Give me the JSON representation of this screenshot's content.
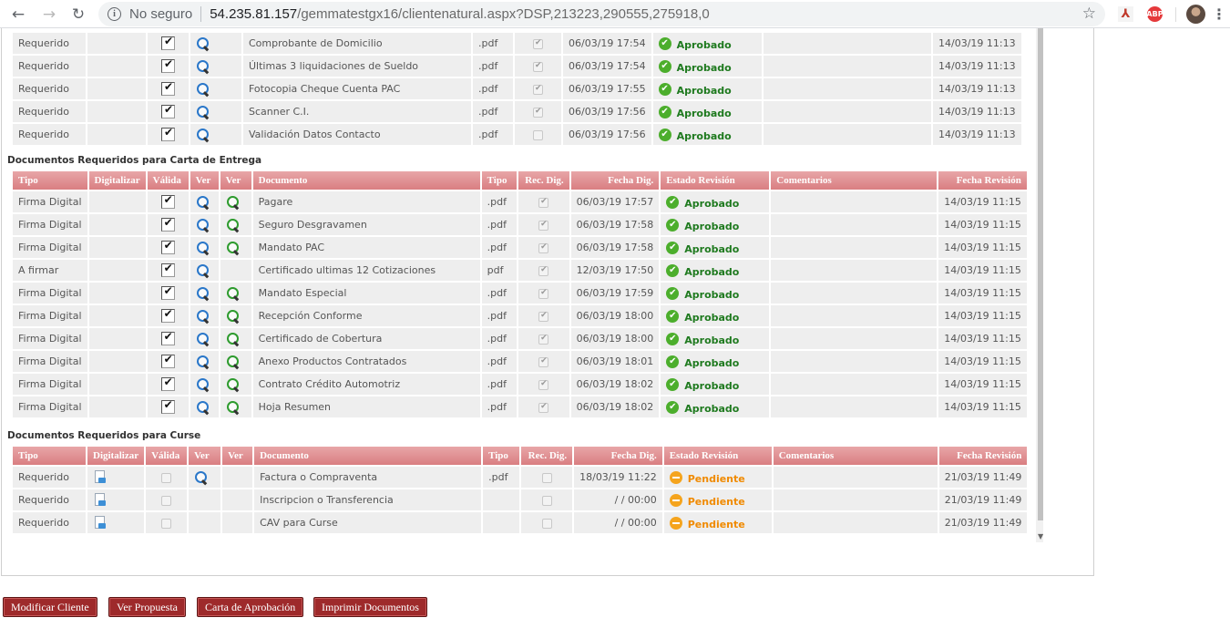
{
  "browser": {
    "security_label": "No seguro",
    "url_host": "54.235.81.157",
    "url_path": "/gemmatestgx16/clientenatural.aspx?DSP,213223,290555,275918,0",
    "pdf_ext_label": "⅄",
    "adblock_ext_label": "ABP"
  },
  "table_top": {
    "rows": [
      {
        "tipo": "Requerido",
        "documento": "Comprobante de Domicilio",
        "ext": ".pdf",
        "fecha_dig": "06/03/19 17:54",
        "estado": "Aprobado",
        "fecha_rev": "14/03/19 11:13"
      },
      {
        "tipo": "Requerido",
        "documento": "Últimas 3 liquidaciones de Sueldo",
        "ext": ".pdf",
        "fecha_dig": "06/03/19 17:54",
        "estado": "Aprobado",
        "fecha_rev": "14/03/19 11:13"
      },
      {
        "tipo": "Requerido",
        "documento": "Fotocopia Cheque Cuenta PAC",
        "ext": ".pdf",
        "fecha_dig": "06/03/19 17:55",
        "estado": "Aprobado",
        "fecha_rev": "14/03/19 11:13"
      },
      {
        "tipo": "Requerido",
        "documento": "Scanner C.I.",
        "ext": ".pdf",
        "fecha_dig": "06/03/19 17:56",
        "estado": "Aprobado",
        "fecha_rev": "14/03/19 11:13"
      },
      {
        "tipo": "Requerido",
        "documento": "Validación Datos Contacto",
        "ext": ".pdf",
        "fecha_dig": "06/03/19 17:56",
        "estado": "Aprobado",
        "fecha_rev": "14/03/19 11:13"
      }
    ]
  },
  "section_carta": {
    "title": "Documentos Requeridos para Carta de Entrega",
    "headers": {
      "tipo": "Tipo",
      "digitalizar": "Digitalizar",
      "valida": "Válida",
      "ver1": "Ver",
      "ver2": "Ver",
      "documento": "Documento",
      "ext": "Tipo",
      "rec_dig": "Rec. Dig.",
      "fecha_dig": "Fecha Dig.",
      "estado": "Estado Revisión",
      "comentarios": "Comentarios",
      "fecha_rev": "Fecha Revisión"
    },
    "rows": [
      {
        "tipo": "Firma Digital",
        "documento": "Pagare",
        "ext": ".pdf",
        "fecha_dig": "06/03/19 17:57",
        "estado": "Aprobado",
        "fecha_rev": "14/03/19 11:15"
      },
      {
        "tipo": "Firma Digital",
        "documento": "Seguro Desgravamen",
        "ext": ".pdf",
        "fecha_dig": "06/03/19 17:58",
        "estado": "Aprobado",
        "fecha_rev": "14/03/19 11:15"
      },
      {
        "tipo": "Firma Digital",
        "documento": "Mandato PAC",
        "ext": ".pdf",
        "fecha_dig": "06/03/19 17:58",
        "estado": "Aprobado",
        "fecha_rev": "14/03/19 11:15"
      },
      {
        "tipo": "A firmar",
        "documento": "Certificado ultimas 12 Cotizaciones",
        "ext": "pdf",
        "fecha_dig": "12/03/19 17:50",
        "estado": "Aprobado",
        "fecha_rev": "14/03/19 11:15"
      },
      {
        "tipo": "Firma Digital",
        "documento": "Mandato Especial",
        "ext": ".pdf",
        "fecha_dig": "06/03/19 17:59",
        "estado": "Aprobado",
        "fecha_rev": "14/03/19 11:15"
      },
      {
        "tipo": "Firma Digital",
        "documento": "Recepción Conforme",
        "ext": ".pdf",
        "fecha_dig": "06/03/19 18:00",
        "estado": "Aprobado",
        "fecha_rev": "14/03/19 11:15"
      },
      {
        "tipo": "Firma Digital",
        "documento": "Certificado de Cobertura",
        "ext": ".pdf",
        "fecha_dig": "06/03/19 18:00",
        "estado": "Aprobado",
        "fecha_rev": "14/03/19 11:15"
      },
      {
        "tipo": "Firma Digital",
        "documento": "Anexo Productos Contratados",
        "ext": ".pdf",
        "fecha_dig": "06/03/19 18:01",
        "estado": "Aprobado",
        "fecha_rev": "14/03/19 11:15"
      },
      {
        "tipo": "Firma Digital",
        "documento": "Contrato Crédito Automotriz",
        "ext": ".pdf",
        "fecha_dig": "06/03/19 18:02",
        "estado": "Aprobado",
        "fecha_rev": "14/03/19 11:15"
      },
      {
        "tipo": "Firma Digital",
        "documento": "Hoja Resumen",
        "ext": ".pdf",
        "fecha_dig": "06/03/19 18:02",
        "estado": "Aprobado",
        "fecha_rev": "14/03/19 11:15"
      }
    ]
  },
  "section_curse": {
    "title": "Documentos Requeridos para Curse",
    "headers": {
      "tipo": "Tipo",
      "digitalizar": "Digitalizar",
      "valida": "Válida",
      "ver1": "Ver",
      "ver2": "Ver",
      "documento": "Documento",
      "ext": "Tipo",
      "rec_dig": "Rec. Dig.",
      "fecha_dig": "Fecha Dig.",
      "estado": "Estado Revisión",
      "comentarios": "Comentarios",
      "fecha_rev": "Fecha Revisión"
    },
    "rows": [
      {
        "tipo": "Requerido",
        "documento": "Factura o Compraventa",
        "ext": ".pdf",
        "fecha_dig": "18/03/19 11:22",
        "estado": "Pendiente",
        "fecha_rev": "21/03/19 11:49"
      },
      {
        "tipo": "Requerido",
        "documento": "Inscripcion o Transferencia",
        "ext": "",
        "fecha_dig": "/ / 00:00",
        "estado": "Pendiente",
        "fecha_rev": "21/03/19 11:49"
      },
      {
        "tipo": "Requerido",
        "documento": "CAV para Curse",
        "ext": "",
        "fecha_dig": "/ / 00:00",
        "estado": "Pendiente",
        "fecha_rev": "21/03/19 11:49"
      }
    ]
  },
  "buttons": {
    "modificar_cliente": "Modificar Cliente",
    "ver_propuesta": "Ver Propuesta",
    "carta_aprobacion": "Carta de Aprobación",
    "imprimir_documentos": "Imprimir Documentos"
  },
  "colors": {
    "header_gradient_top": "#e8a6a8",
    "header_gradient_bottom": "#d97e81",
    "button_bg": "#9e2a2b",
    "approved": "#1f7a1f",
    "pending": "#f08a00"
  }
}
